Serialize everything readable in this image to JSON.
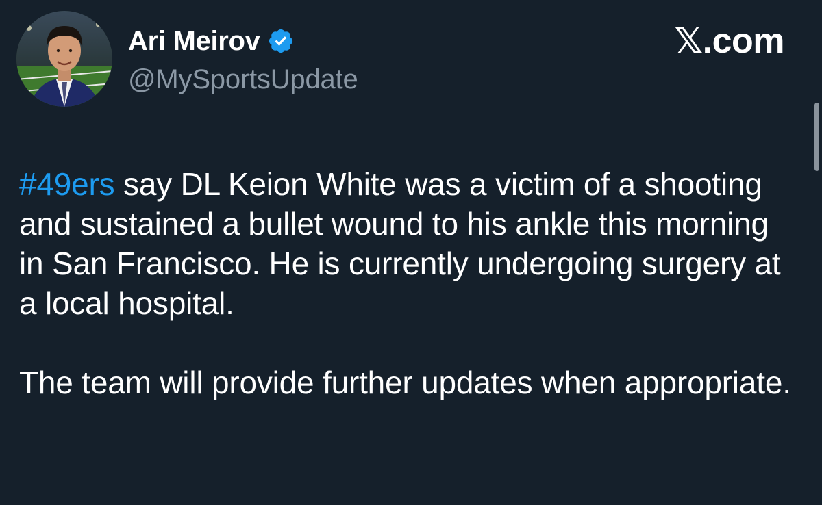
{
  "author": {
    "display_name": "Ari Meirov",
    "handle": "@MySportsUpdate",
    "verified": true,
    "avatar_icon": "profile-photo"
  },
  "brand": {
    "label": "𝕏.com"
  },
  "tweet": {
    "hashtag": "#49ers",
    "paragraph1_rest": " say DL Keion White was a victim of a shooting and sustained a bullet wound to his ankle this morning in San Francisco. He is currently undergoing surgery at a local hospital.",
    "paragraph2": "The team will provide further updates when appropriate."
  },
  "colors": {
    "background": "#15202b",
    "text": "#ffffff",
    "secondary_text": "#8b98a5",
    "accent": "#1d9bf0"
  },
  "icons": {
    "verified": "verified-badge-icon"
  }
}
